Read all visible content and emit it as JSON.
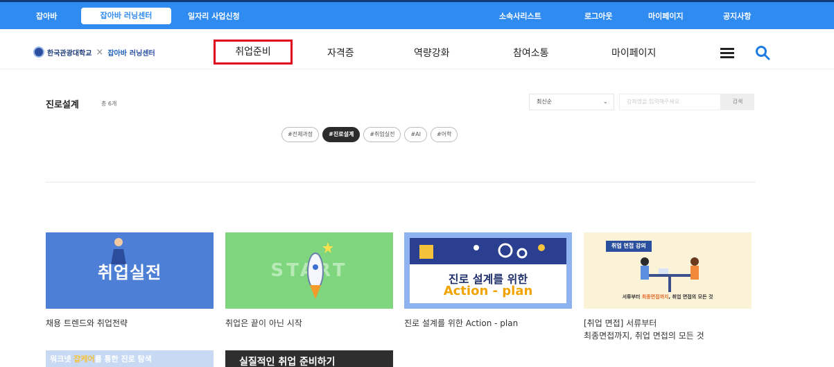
{
  "topbar": {
    "link1": "잡아바",
    "learning_center": "잡아바 러닝센터",
    "jobs_apply": "일자리 사업신청",
    "org_list": "소속사리스트",
    "logout": "로그아웃",
    "mypage": "마이페이지",
    "notice": "공지사항"
  },
  "logo": {
    "college": "한국관광대학교",
    "separator": "×",
    "center_prefix": "잡아바",
    "center_name": "러닝센터"
  },
  "nav": {
    "items": [
      "취업준비",
      "자격증",
      "역량강화",
      "참여소통",
      "마이페이지"
    ],
    "active": "취업준비"
  },
  "section": {
    "title": "진로설계",
    "count": "총 6개",
    "sort_value": "최신순",
    "search_placeholder": "강좌명을 입력해주세요",
    "search_button": "검색"
  },
  "tags": [
    "#전체과정",
    "#진로설계",
    "#취업실전",
    "#AI",
    "#어학"
  ],
  "cards": [
    {
      "thumb_text": "취업실전",
      "caption": "채용 트렌드와 취업전략"
    },
    {
      "thumb_text": "START",
      "caption": "취업은 끝이 아닌 시작"
    },
    {
      "thumb_line1": "진로 설계를 위한",
      "thumb_line2": "Action - plan",
      "caption": "진로 설계를 위한 Action - plan"
    },
    {
      "thumb_badge": "취업 면접 강의",
      "thumb_foot_a": "서류부터 ",
      "thumb_foot_b": "최종면접까지",
      "thumb_foot_c": ", 취업 면접의 모든 것",
      "caption_line1": "[취업 면접] 서류부터",
      "caption_line2": "최종면접까지, 취업 면접의 모든 것"
    }
  ],
  "bottom_cards": [
    {
      "text_a": "워크넷 ",
      "text_b": "잡케어",
      "text_c": "를 통한 진로 탐색"
    },
    {
      "text": "실질적인 취업 준비하기"
    }
  ],
  "colors": {
    "topbar": "#2f8bf0",
    "active_outline": "#e3001b",
    "accent": "#2f8bf0"
  }
}
